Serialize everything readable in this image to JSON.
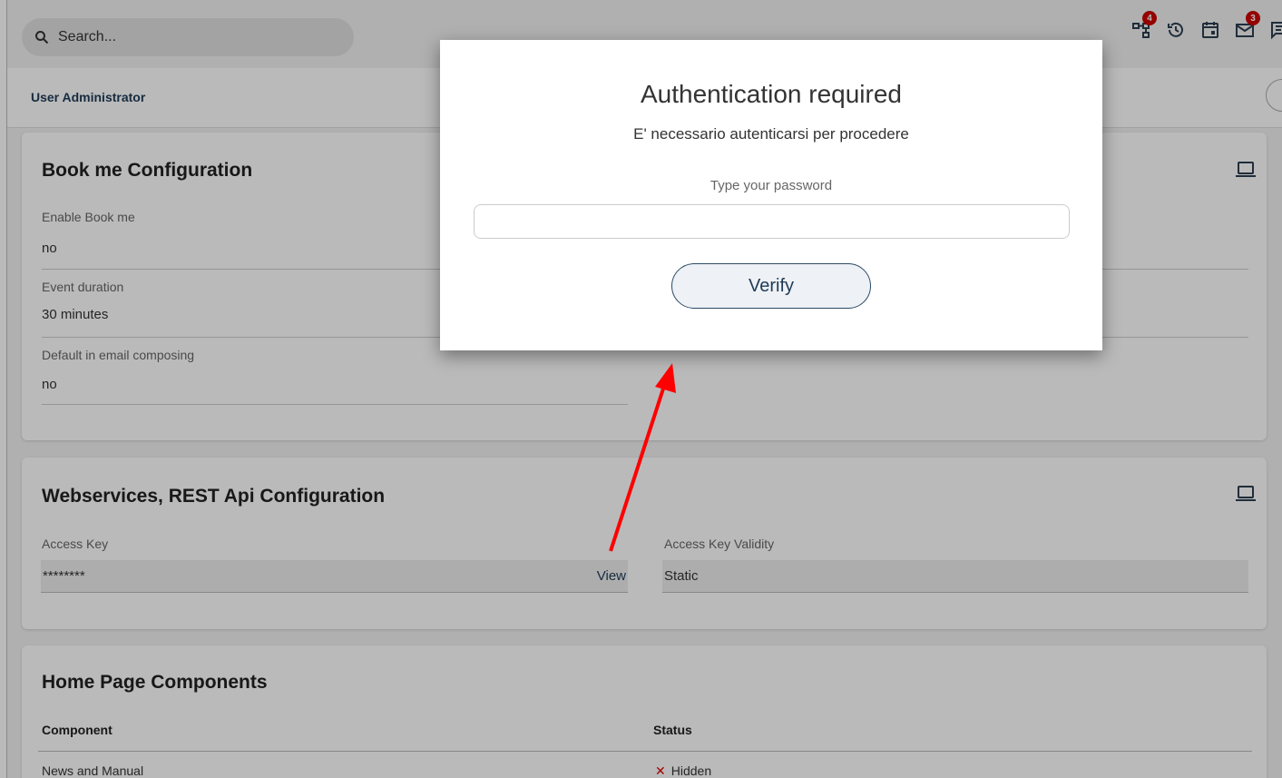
{
  "search": {
    "placeholder": "Search..."
  },
  "top_icons": [
    {
      "name": "org-chart-icon",
      "badge": "4"
    },
    {
      "name": "history-icon",
      "badge": ""
    },
    {
      "name": "calendar-icon",
      "badge": ""
    },
    {
      "name": "mail-icon",
      "badge": "3"
    },
    {
      "name": "chat-icon",
      "badge": ""
    }
  ],
  "header": {
    "title": "User Administrator"
  },
  "bookme": {
    "title": "Book me Configuration",
    "fields": [
      {
        "label": "Enable Book me",
        "value": "no"
      },
      {
        "label": "Event duration",
        "value": "30 minutes"
      },
      {
        "label": "Default in email composing",
        "value": "no"
      }
    ]
  },
  "webservices": {
    "title": "Webservices, REST Api Configuration",
    "access_key_label": "Access Key",
    "access_key_value": "********",
    "view_label": "View",
    "validity_label": "Access Key Validity",
    "validity_value": "Static"
  },
  "homepage": {
    "title": "Home Page Components",
    "col_component": "Component",
    "col_status": "Status",
    "rows": [
      {
        "component": "News and Manual",
        "status_icon": "✕",
        "status": "Hidden"
      }
    ]
  },
  "modal": {
    "title": "Authentication required",
    "message": "E' necessario autenticarsi per procedere",
    "password_label": "Type your password",
    "password_value": "",
    "verify_label": "Verify"
  },
  "colors": {
    "accent": "#1f3b57",
    "annotation": "#ff0000",
    "hidden": "#dd0000"
  }
}
